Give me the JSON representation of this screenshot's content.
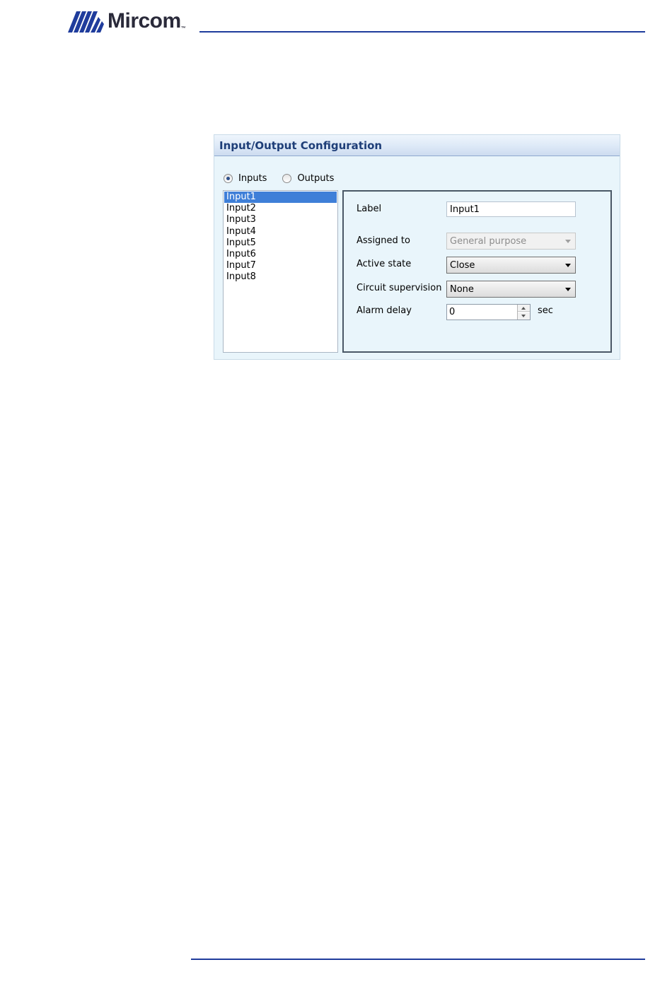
{
  "header": {
    "brand": "Mircom",
    "trademark": "™"
  },
  "panel": {
    "title": "Input/Output Configuration",
    "mode": {
      "inputs_label": "Inputs",
      "outputs_label": "Outputs",
      "selected": "Inputs"
    },
    "list": {
      "items": [
        {
          "label": "Input1",
          "selected": true
        },
        {
          "label": "Input2"
        },
        {
          "label": "Input3"
        },
        {
          "label": "Input4"
        },
        {
          "label": "Input5"
        },
        {
          "label": "Input6"
        },
        {
          "label": "Input7"
        },
        {
          "label": "Input8"
        }
      ]
    },
    "properties": {
      "label": {
        "caption": "Label",
        "value": "Input1"
      },
      "assigned_to": {
        "caption": "Assigned to",
        "value": "General purpose",
        "disabled": true
      },
      "active_state": {
        "caption": "Active state",
        "value": "Close"
      },
      "circuit_supervision": {
        "caption": "Circuit supervision",
        "value": "None"
      },
      "alarm_delay": {
        "caption": "Alarm delay",
        "value": "0",
        "unit": "sec"
      }
    }
  },
  "colors": {
    "brand_blue": "#1f3c9c",
    "panel_bg": "#e9f5fb",
    "title_text": "#1e3e78",
    "selection": "#3f7fd8"
  }
}
